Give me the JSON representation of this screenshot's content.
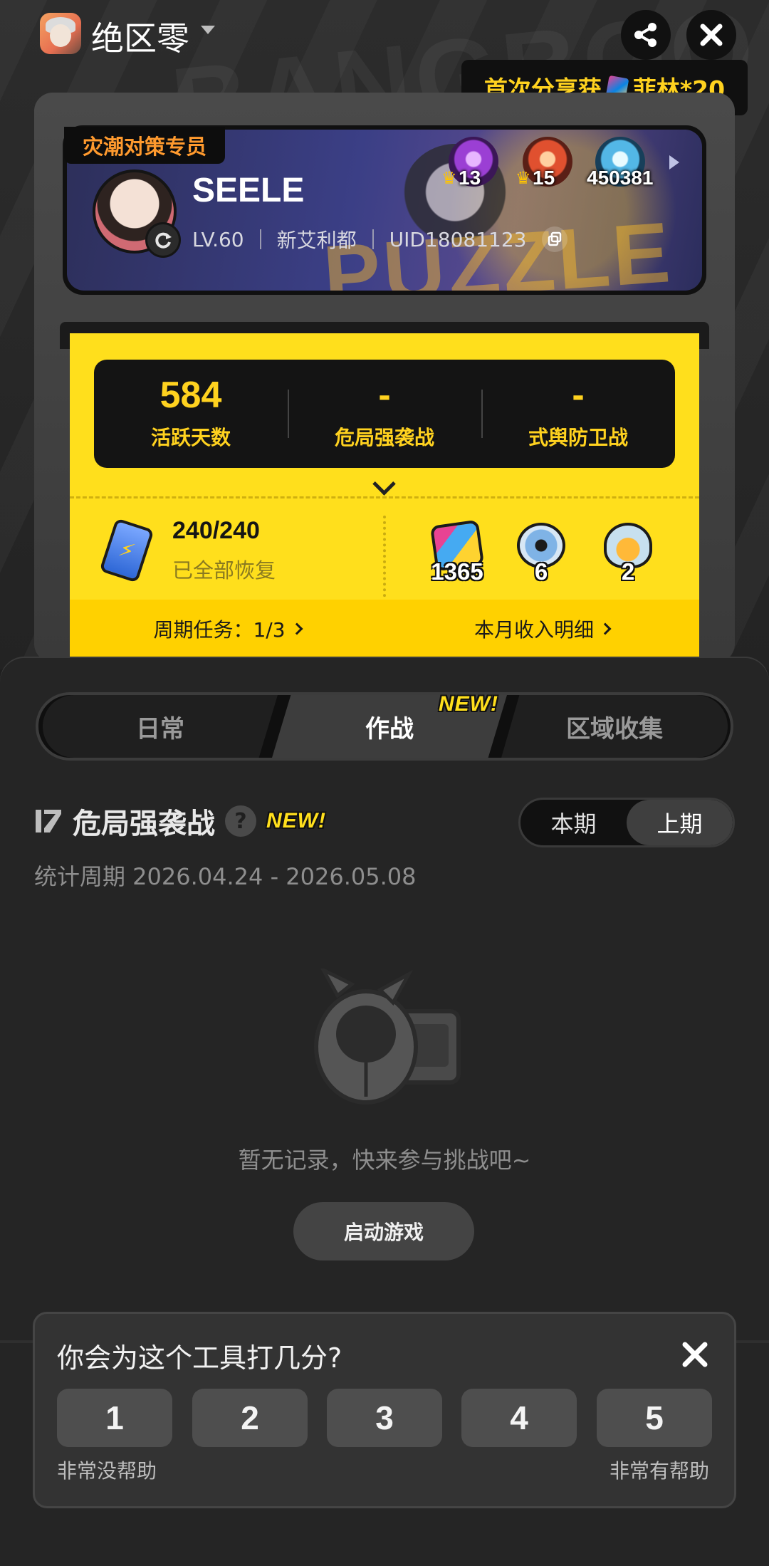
{
  "header": {
    "app_name": "绝区零",
    "share_icon": "share-icon",
    "close_icon": "close-icon"
  },
  "share_tip": {
    "text": "首次分享获",
    "reward": "菲林*20",
    "icon": "film-ticket-icon"
  },
  "profile": {
    "title_tag": "灾潮对策专员",
    "username": "SEELE",
    "level": "LV.60",
    "server": "新艾利都",
    "uid": "UID18081123",
    "badges": [
      {
        "icon": "purple-medal-icon",
        "label": "13",
        "crowned": true
      },
      {
        "icon": "orange-medal-icon",
        "label": "15",
        "crowned": true
      },
      {
        "icon": "blue-medal-icon",
        "label": "450381",
        "crowned": false
      }
    ]
  },
  "stats": [
    {
      "value": "584",
      "label": "活跃天数"
    },
    {
      "value": "-",
      "label": "危局强袭战"
    },
    {
      "value": "-",
      "label": "式舆防卫战"
    }
  ],
  "stamina": {
    "value": "240/240",
    "status": "已全部恢复"
  },
  "resources": [
    {
      "icon": "film-ticket-icon",
      "count": "1365"
    },
    {
      "icon": "film-reel-icon",
      "count": "6"
    },
    {
      "icon": "bunny-token-icon",
      "count": "2"
    }
  ],
  "footer_links": {
    "tasks": "周期任务：1/3",
    "income": "本月收入明细"
  },
  "tabs": [
    {
      "label": "日常",
      "active": false
    },
    {
      "label": "作战",
      "active": true,
      "badge": "NEW!"
    },
    {
      "label": "区域收集",
      "active": false
    }
  ],
  "section": {
    "title": "危局强袭战",
    "badge": "NEW!",
    "period_options": [
      "本期",
      "上期"
    ],
    "active_period": "上期",
    "stat_period": "统计周期 2026.04.24 - 2026.05.08"
  },
  "empty_state": {
    "message": "暂无记录，快来参与挑战吧~",
    "button": "启动游戏"
  },
  "rating": {
    "question": "你会为这个工具打几分?",
    "options": [
      "1",
      "2",
      "3",
      "4",
      "5"
    ],
    "low_label": "非常没帮助",
    "high_label": "非常有帮助"
  },
  "colors": {
    "accent_yellow": "#ffdf1c",
    "panel_dark": "#141414",
    "sheet_bg": "#252525",
    "tag_orange": "#ff9a2e"
  }
}
